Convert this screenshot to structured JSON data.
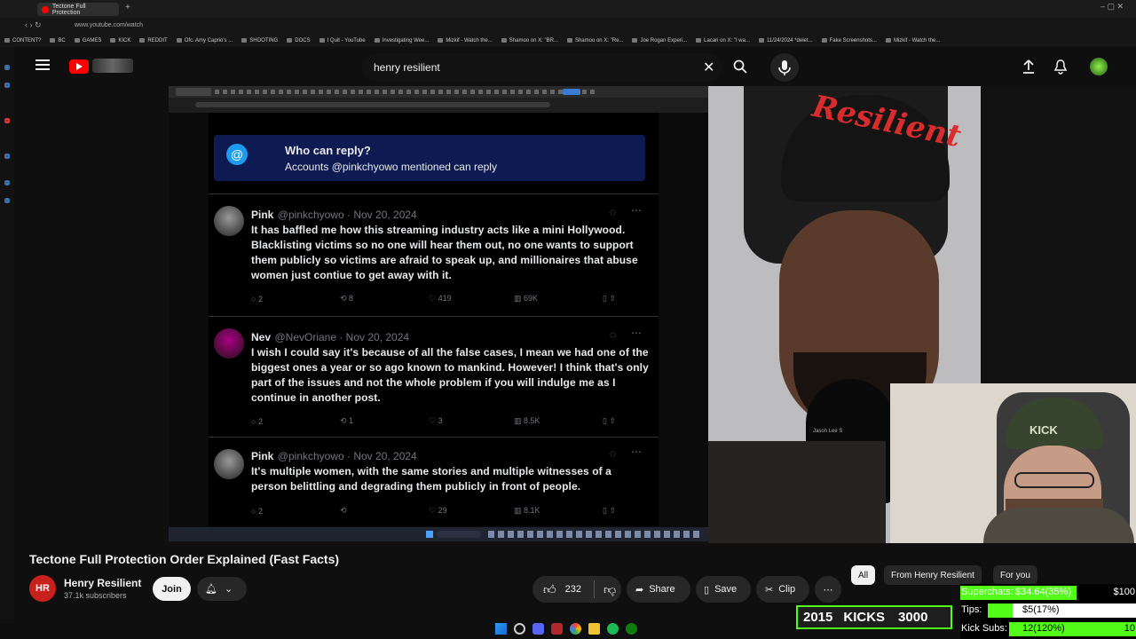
{
  "browser": {
    "active_tab": "Tectone Full Protection",
    "url": "www.youtube.com/watch",
    "bookmarks": [
      "CONTENT?",
      "BC",
      "GAMES",
      "KICK",
      "REDDIT",
      "Ofc. Amy Caprio's ...",
      "SHOOTING",
      "DOCS",
      "I Quit - YouTube",
      "Investigating Wee...",
      "Mizkif - Watch the...",
      "Shamoo on X: \"BR...",
      "Shamoo on X: \"Re...",
      "Joe Rogan Experi...",
      "Lacari on X: \"I wa...",
      "11/24/2024 *delet...",
      "Fake Screenshots...",
      "Mizkif - Watch the..."
    ]
  },
  "header": {
    "search_query": "henry resilient"
  },
  "video_content": {
    "reply_box": {
      "title": "Who can reply?",
      "subtitle": "Accounts @pinkchyowo mentioned can reply"
    },
    "tweets": [
      {
        "name": "Pink",
        "handle": "@pinkchyowo · Nov 20, 2024",
        "body": "It has baffled me how this streaming industry acts like a mini Hollywood. Blacklisting victims so no one will hear them out, no one wants to support them publicly so victims are afraid to speak up, and millionaires that abuse women just contiue to get away with it.",
        "replies": "2",
        "reposts": "8",
        "likes": "419",
        "views": "69K"
      },
      {
        "name": "Nev",
        "handle": "@NevOriane · Nov 20, 2024",
        "body": "I wish I could say it's because of all the false cases, I mean we had one of the biggest ones a year or so ago known to mankind. However! I think that's only part of the issues and not the whole problem if you will indulge me as I continue in another post.",
        "replies": "2",
        "reposts": "1",
        "likes": "3",
        "views": "8.5K"
      },
      {
        "name": "Pink",
        "handle": "@pinkchyowo · Nov 20, 2024",
        "body": "It's multiple women, with the same stories and multiple witnesses of a person belittling and degrading them publicly in front of people.",
        "replies": "2",
        "reposts": "",
        "likes": "29",
        "views": "8.1K"
      }
    ],
    "cap_text": "Resilient",
    "cap2_text": "KICK",
    "mic_text": "Jason Lee S"
  },
  "video_info": {
    "title": "Tectone Full Protection Order Explained (Fast Facts)",
    "channel": "Henry Resilient",
    "subscribers": "37.1k subscribers",
    "join_label": "Join",
    "likes": "232",
    "share_label": "Share",
    "save_label": "Save",
    "clip_label": "Clip"
  },
  "chips": [
    "All",
    "From Henry Resilient",
    "For you"
  ],
  "overlay": {
    "kicks_count": "2015",
    "kicks_label": "KICKS",
    "kicks_goal": "3000",
    "superchats_label": "Superchats:",
    "superchats_value": "$34.64(35%)",
    "superchats_goal": "$100",
    "superchats_fraction": 0.35,
    "tips_label": "Tips:",
    "tips_value": "$5(17%)",
    "tips_goal": "$30",
    "tips_fraction": 0.17,
    "subs_label": "Kick Subs:",
    "subs_value": "12(120%)",
    "subs_goal": "10",
    "subs_fraction": 1.0
  },
  "colors": {
    "youtube_red": "#ff0000",
    "kick_green": "#53fc18",
    "reply_box": "#0e1b52"
  }
}
